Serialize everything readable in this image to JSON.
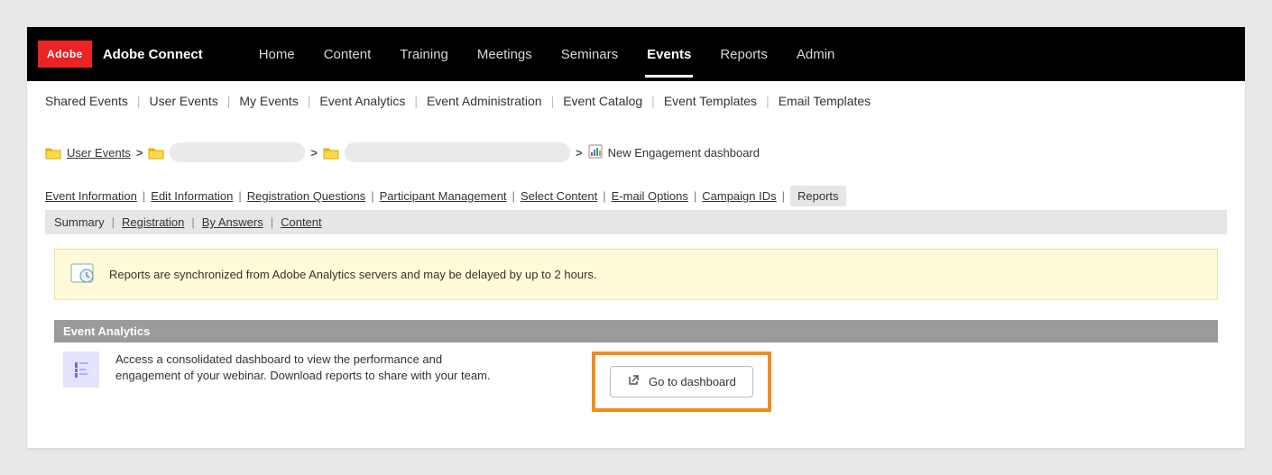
{
  "brand": {
    "logo": "Adobe",
    "name": "Adobe Connect"
  },
  "topnav": {
    "items": [
      {
        "label": "Home",
        "active": false
      },
      {
        "label": "Content",
        "active": false
      },
      {
        "label": "Training",
        "active": false
      },
      {
        "label": "Meetings",
        "active": false
      },
      {
        "label": "Seminars",
        "active": false
      },
      {
        "label": "Events",
        "active": true
      },
      {
        "label": "Reports",
        "active": false
      },
      {
        "label": "Admin",
        "active": false
      }
    ]
  },
  "subnav": {
    "items": [
      "Shared Events",
      "User Events",
      "My Events",
      "Event Analytics",
      "Event Administration",
      "Event Catalog",
      "Event Templates",
      "Email Templates"
    ]
  },
  "breadcrumb": {
    "root": "User Events",
    "leaf": "New Engagement dashboard"
  },
  "detail_tabs": {
    "links": [
      "Event Information",
      "Edit Information",
      "Registration Questions",
      "Participant Management",
      "Select Content",
      "E-mail Options",
      "Campaign IDs"
    ],
    "active": "Reports"
  },
  "report_subtabs": {
    "plain": "Summary",
    "links": [
      "Registration",
      "By Answers",
      "Content"
    ]
  },
  "notice": {
    "text": "Reports are synchronized from Adobe Analytics servers and may be delayed by up to 2 hours."
  },
  "section": {
    "title": "Event Analytics",
    "description": "Access a consolidated dashboard to view the performance and engagement of your webinar. Download reports to share with your team.",
    "cta_label": "Go to dashboard"
  }
}
